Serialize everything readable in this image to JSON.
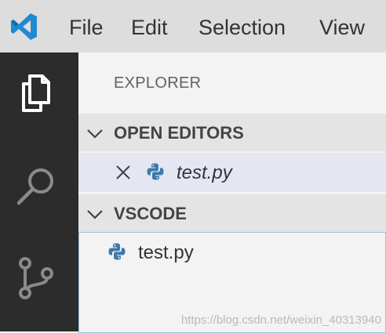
{
  "menu": [
    "File",
    "Edit",
    "Selection",
    "View"
  ],
  "icons": {
    "logo": "vscode-logo",
    "explorer": "files-icon",
    "search": "search-icon",
    "scm": "source-control-icon",
    "python": "python-icon"
  },
  "colors": {
    "titlebar": "#dddddd",
    "activitybar": "#2c2c2c",
    "sidebar": "#f3f3f3",
    "section_header": "#e4e4e4",
    "selected_row": "#e4e6f1",
    "brand_blue": "#007acc",
    "python_blue": "#3e7aab"
  },
  "sidebar": {
    "title": "EXPLORER",
    "open_editors": {
      "header": "OPEN EDITORS",
      "items": [
        {
          "label": "test.py"
        }
      ]
    },
    "folder": {
      "header": "VSCODE",
      "items": [
        {
          "label": "test.py"
        }
      ]
    }
  },
  "watermark": "https://blog.csdn.net/weixin_40313940"
}
